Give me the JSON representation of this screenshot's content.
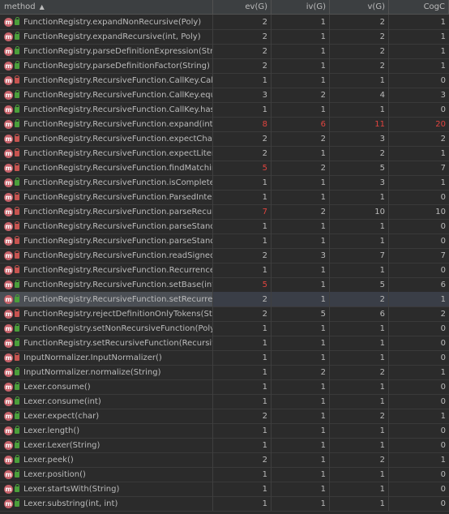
{
  "columns": {
    "method": "method",
    "ev": "ev(G)",
    "iv": "iv(G)",
    "v": "v(G)",
    "cog": "CogC"
  },
  "rows": [
    {
      "method": "FunctionRegistry.expandNonRecursive(Poly)",
      "vis": "pub",
      "ev": "2",
      "iv": "1",
      "v": "2",
      "cog": "1"
    },
    {
      "method": "FunctionRegistry.expandRecursive(int, Poly)",
      "vis": "pub",
      "ev": "2",
      "iv": "1",
      "v": "2",
      "cog": "1"
    },
    {
      "method": "FunctionRegistry.parseDefinitionExpression(String)",
      "vis": "pub",
      "ev": "2",
      "iv": "1",
      "v": "2",
      "cog": "1"
    },
    {
      "method": "FunctionRegistry.parseDefinitionFactor(String)",
      "vis": "pub",
      "ev": "2",
      "iv": "1",
      "v": "2",
      "cog": "1"
    },
    {
      "method": "FunctionRegistry.RecursiveFunction.CallKey.CallKey(int, I",
      "vis": "priv",
      "ev": "1",
      "iv": "1",
      "v": "1",
      "cog": "0"
    },
    {
      "method": "FunctionRegistry.RecursiveFunction.CallKey.equals(Obje",
      "vis": "pub",
      "ev": "3",
      "iv": "2",
      "v": "4",
      "cog": "3"
    },
    {
      "method": "FunctionRegistry.RecursiveFunction.CallKey.hashCode()",
      "vis": "pub",
      "ev": "1",
      "iv": "1",
      "v": "1",
      "cog": "0"
    },
    {
      "method": "FunctionRegistry.RecursiveFunction.expand(int, Poly)",
      "vis": "pub",
      "ev": "8",
      "iv": "6",
      "v": "11",
      "cog": "20",
      "red": true
    },
    {
      "method": "FunctionRegistry.RecursiveFunction.expectChar(String, in",
      "vis": "priv",
      "ev": "2",
      "iv": "2",
      "v": "3",
      "cog": "2"
    },
    {
      "method": "FunctionRegistry.RecursiveFunction.expectLiteral(String,",
      "vis": "priv",
      "ev": "2",
      "iv": "1",
      "v": "2",
      "cog": "1"
    },
    {
      "method": "FunctionRegistry.RecursiveFunction.findMatchingParen(S",
      "vis": "priv",
      "ev": "5",
      "iv": "2",
      "v": "5",
      "cog": "7",
      "evRed": true
    },
    {
      "method": "FunctionRegistry.RecursiveFunction.isComplete()",
      "vis": "pub",
      "ev": "1",
      "iv": "1",
      "v": "3",
      "cog": "1"
    },
    {
      "method": "FunctionRegistry.RecursiveFunction.ParsedInteger.Parse",
      "vis": "priv",
      "ev": "1",
      "iv": "1",
      "v": "1",
      "cog": "0"
    },
    {
      "method": "FunctionRegistry.RecursiveFunction.parseRecurrence(Str",
      "vis": "priv",
      "ev": "7",
      "iv": "2",
      "v": "10",
      "cog": "10",
      "evRed": true
    },
    {
      "method": "FunctionRegistry.RecursiveFunction.parseStandaloneExp",
      "vis": "priv",
      "ev": "1",
      "iv": "1",
      "v": "1",
      "cog": "0"
    },
    {
      "method": "FunctionRegistry.RecursiveFunction.parseStandaloneFac",
      "vis": "priv",
      "ev": "1",
      "iv": "1",
      "v": "1",
      "cog": "0"
    },
    {
      "method": "FunctionRegistry.RecursiveFunction.readSignedInteger(S",
      "vis": "priv",
      "ev": "2",
      "iv": "3",
      "v": "7",
      "cog": "7"
    },
    {
      "method": "FunctionRegistry.RecursiveFunction.Recurrence.Recurre",
      "vis": "priv",
      "ev": "1",
      "iv": "1",
      "v": "1",
      "cog": "0"
    },
    {
      "method": "FunctionRegistry.RecursiveFunction.setBase(int, Poly)",
      "vis": "pub",
      "ev": "5",
      "iv": "1",
      "v": "5",
      "cog": "6",
      "evRed": true
    },
    {
      "method": "FunctionRegistry.RecursiveFunction.setRecurrence(Recurrence)",
      "vis": "pub",
      "ev": "2",
      "iv": "1",
      "v": "2",
      "cog": "1",
      "selected": true
    },
    {
      "method": "FunctionRegistry.rejectDefinitionOnlyTokens(String)",
      "vis": "priv",
      "ev": "2",
      "iv": "5",
      "v": "6",
      "cog": "2"
    },
    {
      "method": "FunctionRegistry.setNonRecursiveFunction(Poly)",
      "vis": "pub",
      "ev": "1",
      "iv": "1",
      "v": "1",
      "cog": "0"
    },
    {
      "method": "FunctionRegistry.setRecursiveFunction(RecursiveFunctio",
      "vis": "pub",
      "ev": "1",
      "iv": "1",
      "v": "1",
      "cog": "0"
    },
    {
      "method": "InputNormalizer.InputNormalizer()",
      "vis": "priv",
      "ev": "1",
      "iv": "1",
      "v": "1",
      "cog": "0"
    },
    {
      "method": "InputNormalizer.normalize(String)",
      "vis": "pub",
      "ev": "1",
      "iv": "2",
      "v": "2",
      "cog": "1"
    },
    {
      "method": "Lexer.consume()",
      "vis": "pub",
      "ev": "1",
      "iv": "1",
      "v": "1",
      "cog": "0"
    },
    {
      "method": "Lexer.consume(int)",
      "vis": "pub",
      "ev": "1",
      "iv": "1",
      "v": "1",
      "cog": "0"
    },
    {
      "method": "Lexer.expect(char)",
      "vis": "pub",
      "ev": "2",
      "iv": "1",
      "v": "2",
      "cog": "1"
    },
    {
      "method": "Lexer.length()",
      "vis": "pub",
      "ev": "1",
      "iv": "1",
      "v": "1",
      "cog": "0"
    },
    {
      "method": "Lexer.Lexer(String)",
      "vis": "pub",
      "ev": "1",
      "iv": "1",
      "v": "1",
      "cog": "0"
    },
    {
      "method": "Lexer.peek()",
      "vis": "pub",
      "ev": "2",
      "iv": "1",
      "v": "2",
      "cog": "1"
    },
    {
      "method": "Lexer.position()",
      "vis": "pub",
      "ev": "1",
      "iv": "1",
      "v": "1",
      "cog": "0"
    },
    {
      "method": "Lexer.startsWith(String)",
      "vis": "pub",
      "ev": "1",
      "iv": "1",
      "v": "1",
      "cog": "0"
    },
    {
      "method": "Lexer.substring(int, int)",
      "vis": "pub",
      "ev": "1",
      "iv": "1",
      "v": "1",
      "cog": "0"
    }
  ],
  "icons": {
    "method_icon": "m",
    "sort_arrow": "▲"
  },
  "colors": {
    "background": "#2b2b2b",
    "header": "#3c3f41",
    "text": "#bbbbbb",
    "highlight_red": "#e0443f",
    "method_icon": "#c7626a",
    "public": "#4b9f3b",
    "private": "#c75450"
  }
}
